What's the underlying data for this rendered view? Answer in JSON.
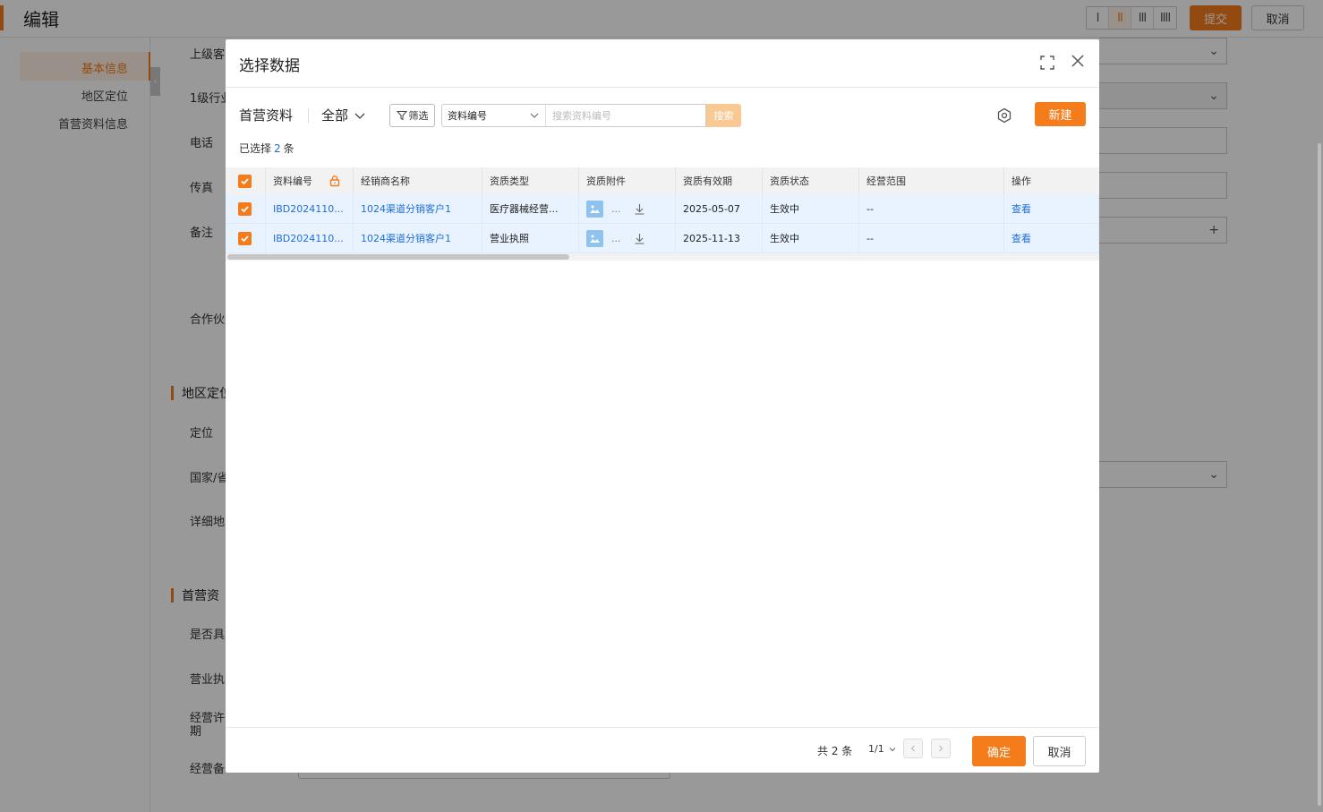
{
  "page": {
    "title": "编辑",
    "layout_options": [
      "I",
      "II",
      "III",
      "IIII"
    ],
    "active_layout_index": 1,
    "submit_label": "提交",
    "cancel_label": "取消"
  },
  "leftnav": {
    "items": [
      {
        "label": "基本信息",
        "active": true
      },
      {
        "label": "地区定位",
        "active": false
      },
      {
        "label": "首营资料信息",
        "active": false
      }
    ],
    "collapse_glyph": "‹"
  },
  "form": {
    "labels": [
      "上级客",
      "1级行业",
      "电话",
      "传真",
      "备注",
      "合作伙",
      "定位",
      "国家/省",
      "详细地",
      "是否具",
      "营业执",
      "经营许",
      "期",
      "经营备"
    ],
    "sections": [
      "地区定位",
      "首营资"
    ]
  },
  "modal": {
    "title": "选择数据",
    "toolbar": {
      "title": "首营资料",
      "scope": "全部",
      "filter_label": "筛选",
      "search_field": "资料编号",
      "search_placeholder": "搜索资料编号",
      "search_button": "搜索",
      "new_button": "新建"
    },
    "selected": {
      "prefix": "已选择",
      "count": "2",
      "suffix": "条"
    },
    "table": {
      "columns": [
        "资料编号",
        "经销商名称",
        "资质类型",
        "资质附件",
        "资质有效期",
        "资质状态",
        "经营范围",
        "操作"
      ],
      "rows": [
        {
          "code": "IBD2024110...",
          "dealer": "1024渠道分销客户1",
          "type": "医疗器械经营...",
          "attachment_more": "...",
          "expiry": "2025-05-07",
          "status": "生效中",
          "scope": "--",
          "action": "查看"
        },
        {
          "code": "IBD2024110...",
          "dealer": "1024渠道分销客户1",
          "type": "营业执照",
          "attachment_more": "...",
          "expiry": "2025-11-13",
          "status": "生效中",
          "scope": "--",
          "action": "查看"
        }
      ]
    },
    "footer": {
      "total": "共 2 条",
      "page": "1/1",
      "ok_label": "确定",
      "cancel_label": "取消"
    }
  },
  "colors": {
    "accent": "#f47c1b",
    "link": "#1e6fd9",
    "selected_row": "#e9f3ff"
  }
}
